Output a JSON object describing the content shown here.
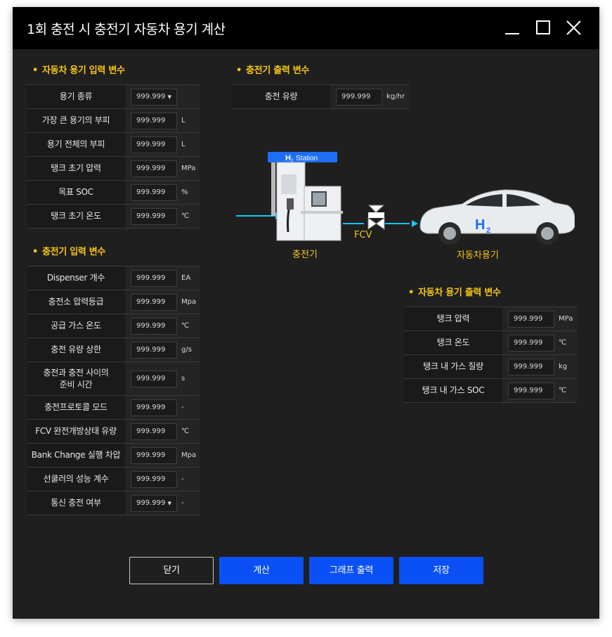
{
  "window": {
    "title": "1회 충전 시 충전기 자동차 용기 계산"
  },
  "vehicle_input": {
    "title": "자동차 용기 입력 변수",
    "rows": [
      {
        "label": "용기 종류",
        "value": "999.999",
        "unit": "",
        "dropdown": true
      },
      {
        "label": "가장 큰 용기의 부피",
        "value": "999.999",
        "unit": "L"
      },
      {
        "label": "용기 전체의 부피",
        "value": "999.999",
        "unit": "L"
      },
      {
        "label": "탱크 초기 압력",
        "value": "999.999",
        "unit": "MPa"
      },
      {
        "label": "목표 SOC",
        "value": "999.999",
        "unit": "%"
      },
      {
        "label": "탱크 초기 온도",
        "value": "999.999",
        "unit": "℃"
      }
    ]
  },
  "charger_input": {
    "title": "충전기 입력 변수",
    "rows": [
      {
        "label": "Dispenser 개수",
        "value": "999.999",
        "unit": "EA"
      },
      {
        "label": "충전소 압력등급",
        "value": "999.999",
        "unit": "Mpa"
      },
      {
        "label": "공급 가스 온도",
        "value": "999.999",
        "unit": "℃"
      },
      {
        "label": "충전 유량 상한",
        "value": "999.999",
        "unit": "g/s"
      },
      {
        "label": "충전과 충전 사이의\n준비 시간",
        "value": "999.999",
        "unit": "s"
      },
      {
        "label": "충전프로토콜 모드",
        "value": "999.999",
        "unit": "-"
      },
      {
        "label": "FCV 완전개방상태 유량",
        "value": "999.999",
        "unit": "℃"
      },
      {
        "label": "Bank Change 실행 차압",
        "value": "999.999",
        "unit": "Mpa"
      },
      {
        "label": "선쿨러의 성능 계수",
        "value": "999.999",
        "unit": "-"
      },
      {
        "label": "통신 충전 여부",
        "value": "999.999",
        "unit": "-",
        "dropdown": true
      }
    ]
  },
  "charger_output": {
    "title": "충전기 출력 변수",
    "rows": [
      {
        "label": "충전 유량",
        "value": "999.999",
        "unit": "kg/hr"
      }
    ]
  },
  "vehicle_output": {
    "title": "자동차 용기 출력 변수",
    "rows": [
      {
        "label": "탱크 압력",
        "value": "999.999",
        "unit": "MPa"
      },
      {
        "label": "탱크 온도",
        "value": "999.999",
        "unit": "℃"
      },
      {
        "label": "탱크 내 가스 질량",
        "value": "999.999",
        "unit": "kg"
      },
      {
        "label": "탱크 내 가스 SOC",
        "value": "999.999",
        "unit": "℃"
      }
    ]
  },
  "diagram": {
    "station_sign": "Station",
    "h2_sign": "H",
    "h2_sub": "2",
    "charger_label": "충전기",
    "valve_label": "FCV",
    "car_label": "자동차용기",
    "car_h2": "H",
    "car_h2_sub": "2"
  },
  "buttons": {
    "close": "닫기",
    "calculate": "계산",
    "graph": "그래프 출력",
    "save": "저장"
  },
  "colors": {
    "accent_yellow": "#f5c518",
    "primary_blue": "#0a50f5",
    "flow_cyan": "#12c8f0"
  }
}
